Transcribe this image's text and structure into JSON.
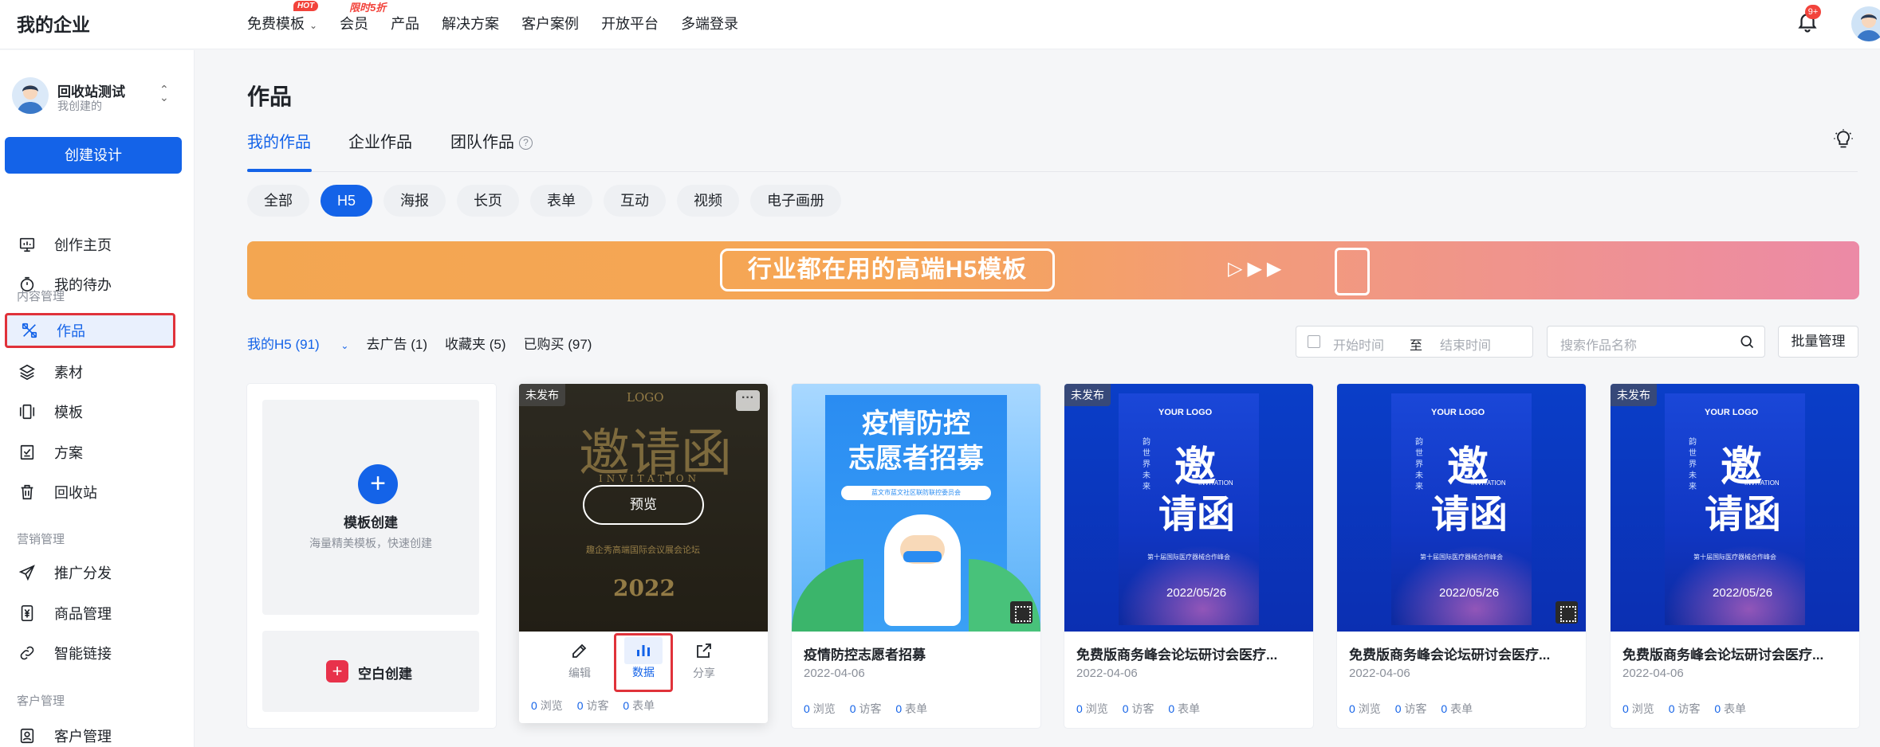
{
  "topbar": {
    "brand": "我的企业",
    "nav": [
      {
        "label": "免费模板",
        "badge": "HOT"
      },
      {
        "label": "会员",
        "badge": "限时5折"
      },
      {
        "label": "产品"
      },
      {
        "label": "解决方案"
      },
      {
        "label": "客户案例"
      },
      {
        "label": "开放平台"
      },
      {
        "label": "多端登录"
      }
    ],
    "notification_count": "9+"
  },
  "sidebar": {
    "account_name": "回收站测试",
    "account_sub": "我创建的",
    "create_button": "创建设计",
    "items_top": [
      {
        "label": "创作主页",
        "icon": "monitor-icon"
      },
      {
        "label": "我的待办",
        "icon": "timer-icon"
      }
    ],
    "section_content": "内容管理",
    "items_content": [
      {
        "label": "作品",
        "icon": "works-icon",
        "active": true
      },
      {
        "label": "素材",
        "icon": "layers-icon"
      },
      {
        "label": "模板",
        "icon": "template-icon"
      },
      {
        "label": "方案",
        "icon": "checklist-icon"
      },
      {
        "label": "回收站",
        "icon": "trash-icon"
      }
    ],
    "section_marketing": "营销管理",
    "items_marketing": [
      {
        "label": "推广分发",
        "icon": "send-icon"
      },
      {
        "label": "商品管理",
        "icon": "yen-icon"
      },
      {
        "label": "智能链接",
        "icon": "link-icon"
      }
    ],
    "section_customer": "客户管理",
    "items_customer": [
      {
        "label": "客户管理",
        "icon": "contact-icon"
      }
    ]
  },
  "main": {
    "title": "作品",
    "tabs": [
      "我的作品",
      "企业作品",
      "团队作品"
    ],
    "help_glyph": "?",
    "filters": [
      "全部",
      "H5",
      "海报",
      "长页",
      "表单",
      "互动",
      "视频",
      "电子画册"
    ],
    "active_filter": "H5",
    "banner_text": "行业都在用的高端H5模板",
    "subfilters": [
      "我的H5 (91)",
      "去广告 (1)",
      "收藏夹 (5)",
      "已购买 (97)"
    ],
    "date_start_placeholder": "开始时间",
    "date_to": "至",
    "date_end_placeholder": "结束时间",
    "search_placeholder": "搜索作品名称",
    "batch_button": "批量管理"
  },
  "create_card": {
    "template_title": "模板创建",
    "template_sub": "海量精美模板，快速创建",
    "blank_title": "空白创建"
  },
  "hover_card": {
    "unpublished": "未发布",
    "art_logo": "LOGO",
    "art_title": "邀请函",
    "art_sub": "INVITATION",
    "art_line": "趣企秀高端国际会议展会论坛",
    "art_year": "2022",
    "preview": "预览",
    "more": "···",
    "actions": [
      "编辑",
      "数据",
      "分享"
    ],
    "stats": {
      "views": "0",
      "views_label": "浏览",
      "visitors": "0",
      "visitors_label": "访客",
      "forms": "0",
      "forms_label": "表单"
    }
  },
  "cards": [
    {
      "kind": "epidemic",
      "title": "疫情防控志愿者招募",
      "date": "2022-04-06",
      "unpublished": "",
      "art_title": "疫情防控\n志愿者招募",
      "art_ribbon": "蓝文市蓝文社区联防联控委员会",
      "qr": true,
      "stats": {
        "views": "0",
        "views_label": "浏览",
        "visitors": "0",
        "visitors_label": "访客",
        "forms": "0",
        "forms_label": "表单"
      }
    },
    {
      "kind": "invitation",
      "title": "免费版商务峰会论坛研讨会医疗...",
      "date": "2022-04-06",
      "unpublished": "未发布",
      "qr": false,
      "stats": {
        "views": "0",
        "views_label": "浏览",
        "visitors": "0",
        "visitors_label": "访客",
        "forms": "0",
        "forms_label": "表单"
      }
    },
    {
      "kind": "invitation",
      "title": "免费版商务峰会论坛研讨会医疗...",
      "date": "2022-04-06",
      "unpublished": "",
      "qr": true,
      "stats": {
        "views": "0",
        "views_label": "浏览",
        "visitors": "0",
        "visitors_label": "访客",
        "forms": "0",
        "forms_label": "表单"
      }
    },
    {
      "kind": "invitation",
      "title": "免费版商务峰会论坛研讨会医疗...",
      "date": "2022-04-06",
      "unpublished": "未发布",
      "qr": false,
      "stats": {
        "views": "0",
        "views_label": "浏览",
        "visitors": "0",
        "visitors_label": "访客",
        "forms": "0",
        "forms_label": "表单"
      }
    }
  ],
  "invitation_art": {
    "logo": "YOUR LOGO",
    "side": "韵 世 界 未 来",
    "char1": "邀",
    "char2": "请函",
    "english": "INVITATION",
    "sub": "第十届国际医疗器械合作峰会",
    "date": "2022/05/26"
  },
  "colors": {
    "accent": "#1463e8",
    "highlight_border": "#e0323a",
    "hot_badge": "#f2433b"
  }
}
